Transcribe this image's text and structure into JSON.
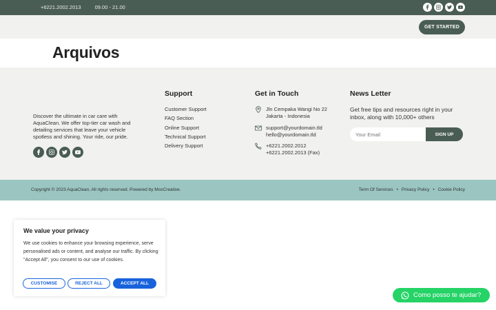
{
  "topbar": {
    "phone": "+6221.2002.2013",
    "hours": "09.00 - 21.00"
  },
  "navbar": {
    "cta_label": "GET STARTED"
  },
  "page": {
    "title": "Arquivos"
  },
  "footer": {
    "about": "Discover the ultimate in car care with AquaClean. We offer top-tier car wash and detailing services that leave your vehicle spotless and shining. Your ride, our pride.",
    "support": {
      "title": "Support",
      "items": [
        "Customer Support",
        "FAQ Section",
        "Online Support",
        "Technical Support",
        "Delivery Support"
      ]
    },
    "contact": {
      "title": "Get in Touch",
      "address_line1": "Jln Cempaka Wangi No 22",
      "address_line2": "Jakarta - Indonesia",
      "email_line1": "support@yourdomain.tld",
      "email_line2": "hello@yourdomain.tld",
      "phone_line1": "+6221.2002.2012",
      "phone_line2": "+6221.2002.2013 (Fax)"
    },
    "newsletter": {
      "title": "News Letter",
      "description": "Get free tips and resources right in your inbox, along with 10,000+ others",
      "placeholder": "Your Email",
      "button": "SIGN UP"
    }
  },
  "bottombar": {
    "copyright": "Copyright © 2023 AquaClean, All rights reserved. Powered by MoxCreative.",
    "links": [
      "Term Of Services",
      "Privacy Policy",
      "Cookie Policy"
    ],
    "separator": "•"
  },
  "cookie": {
    "title": "We value your privacy",
    "body": "We use cookies to enhance your browsing experience, serve personalised ads or content, and analyse our traffic. By clicking \"Accept All\", you consent to our use of cookies.",
    "customise": "CUSTOMISE",
    "reject": "REJECT ALL",
    "accept": "ACCEPT ALL"
  },
  "whatsapp": {
    "label": "Como posso te ajudar?"
  },
  "colors": {
    "primary": "#4a5d55",
    "teal_bar": "#9ac5c1",
    "cookie_blue": "#1863dc",
    "whatsapp": "#25d366"
  },
  "icons": [
    "facebook-icon",
    "instagram-icon",
    "twitter-icon",
    "youtube-icon",
    "map-pin-icon",
    "mail-icon",
    "phone-icon",
    "whatsapp-icon"
  ]
}
